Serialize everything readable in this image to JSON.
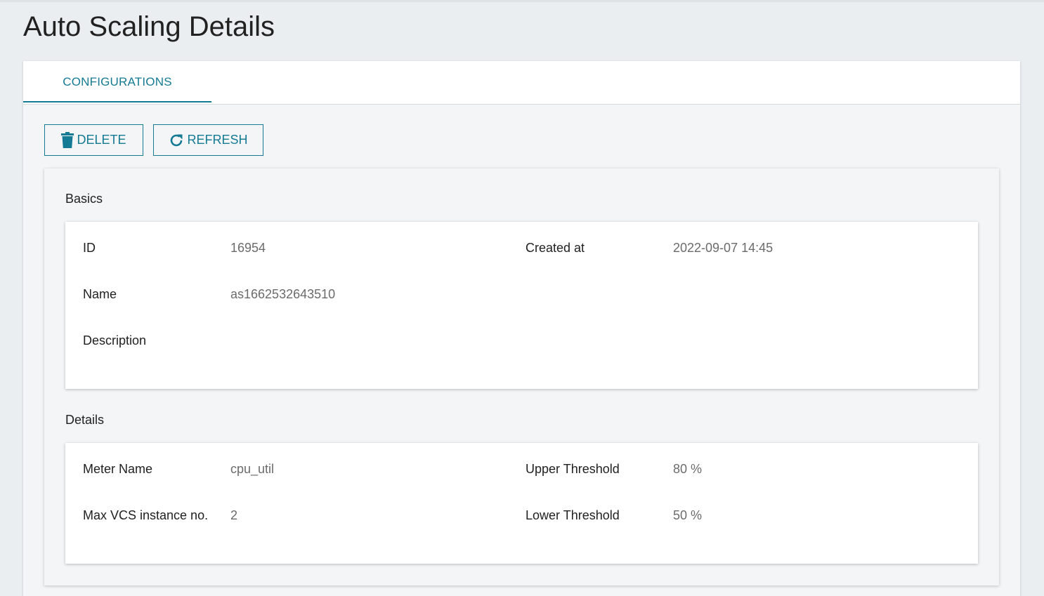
{
  "page": {
    "title": "Auto Scaling Details"
  },
  "tabs": [
    {
      "label": "CONFIGURATIONS",
      "active": true
    }
  ],
  "toolbar": {
    "delete_label": "DELETE",
    "refresh_label": "REFRESH",
    "delete_icon": "trash-icon",
    "refresh_icon": "refresh-icon"
  },
  "basics": {
    "title": "Basics",
    "id_label": "ID",
    "id_value": "16954",
    "created_label": "Created at",
    "created_value": "2022-09-07 14:45",
    "name_label": "Name",
    "name_value": "as1662532643510",
    "description_label": "Description",
    "description_value": ""
  },
  "details": {
    "title": "Details",
    "meter_label": "Meter Name",
    "meter_value": "cpu_util",
    "upper_label": "Upper Threshold",
    "upper_value": "80 %",
    "max_label": "Max VCS instance no.",
    "max_value": "2",
    "lower_label": "Lower Threshold",
    "lower_value": "50 %"
  },
  "colors": {
    "accent": "#157a93",
    "background": "#eaeef1",
    "value_text": "#6b6b6b"
  }
}
